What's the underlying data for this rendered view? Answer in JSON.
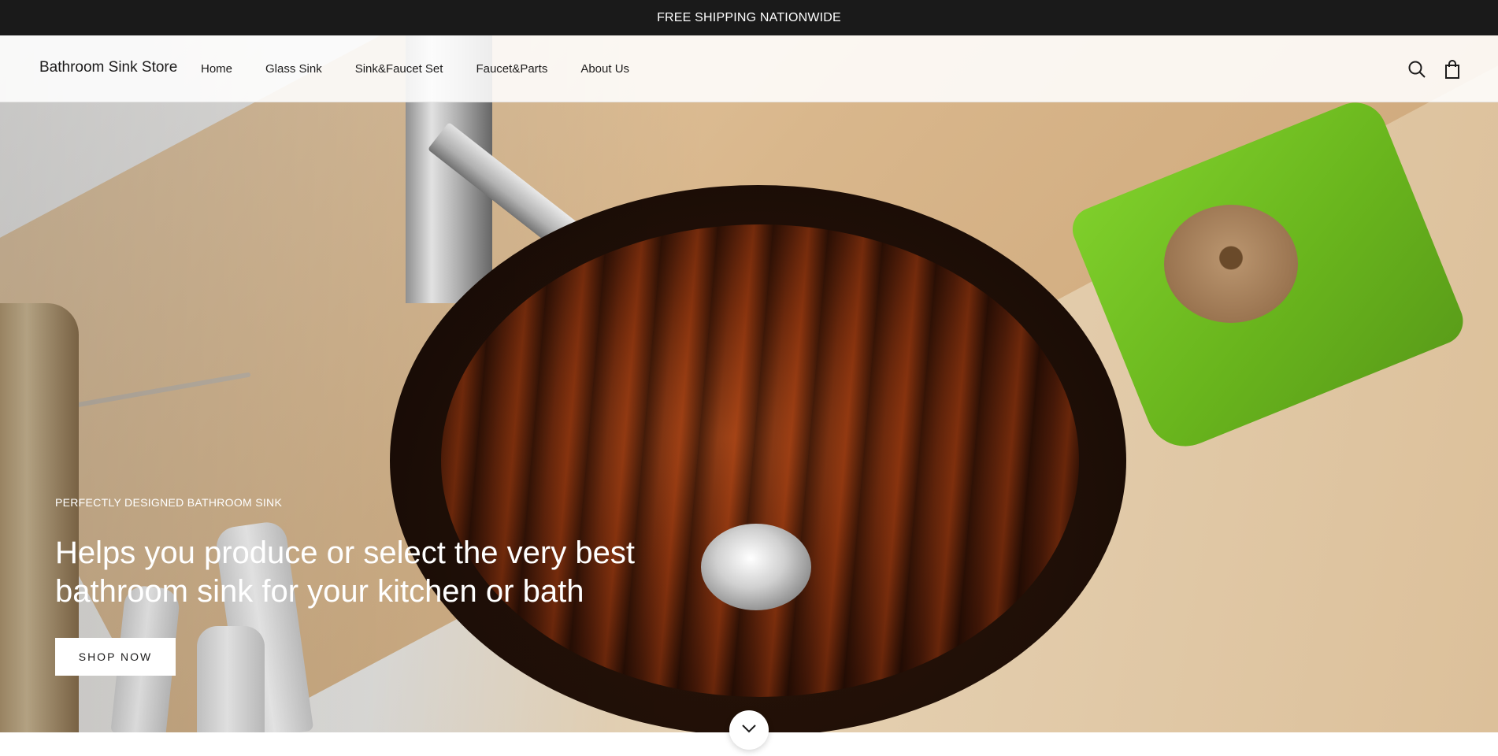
{
  "announcement": {
    "text": "FREE SHIPPING NATIONWIDE"
  },
  "header": {
    "logo": "Bathroom Sink Store",
    "nav": [
      {
        "label": "Home"
      },
      {
        "label": "Glass Sink"
      },
      {
        "label": "Sink&Faucet Set"
      },
      {
        "label": "Faucet&Parts"
      },
      {
        "label": "About Us"
      }
    ],
    "icons": {
      "search": "search-icon",
      "cart": "shopping-bag-icon"
    }
  },
  "hero": {
    "subheading": "PERFECTLY DESIGNED BATHROOM SINK",
    "heading": "Helps you produce or select the very best bathroom sink for your kitchen or bath",
    "button_label": "SHOP NOW",
    "slides": {
      "count": 2,
      "active_index": 1
    },
    "scroll_icon": "chevron-down-icon"
  },
  "colors": {
    "announcement_bg": "#1a1a1a",
    "text_dark": "#1c1b1b",
    "hero_text": "#ffffff"
  }
}
